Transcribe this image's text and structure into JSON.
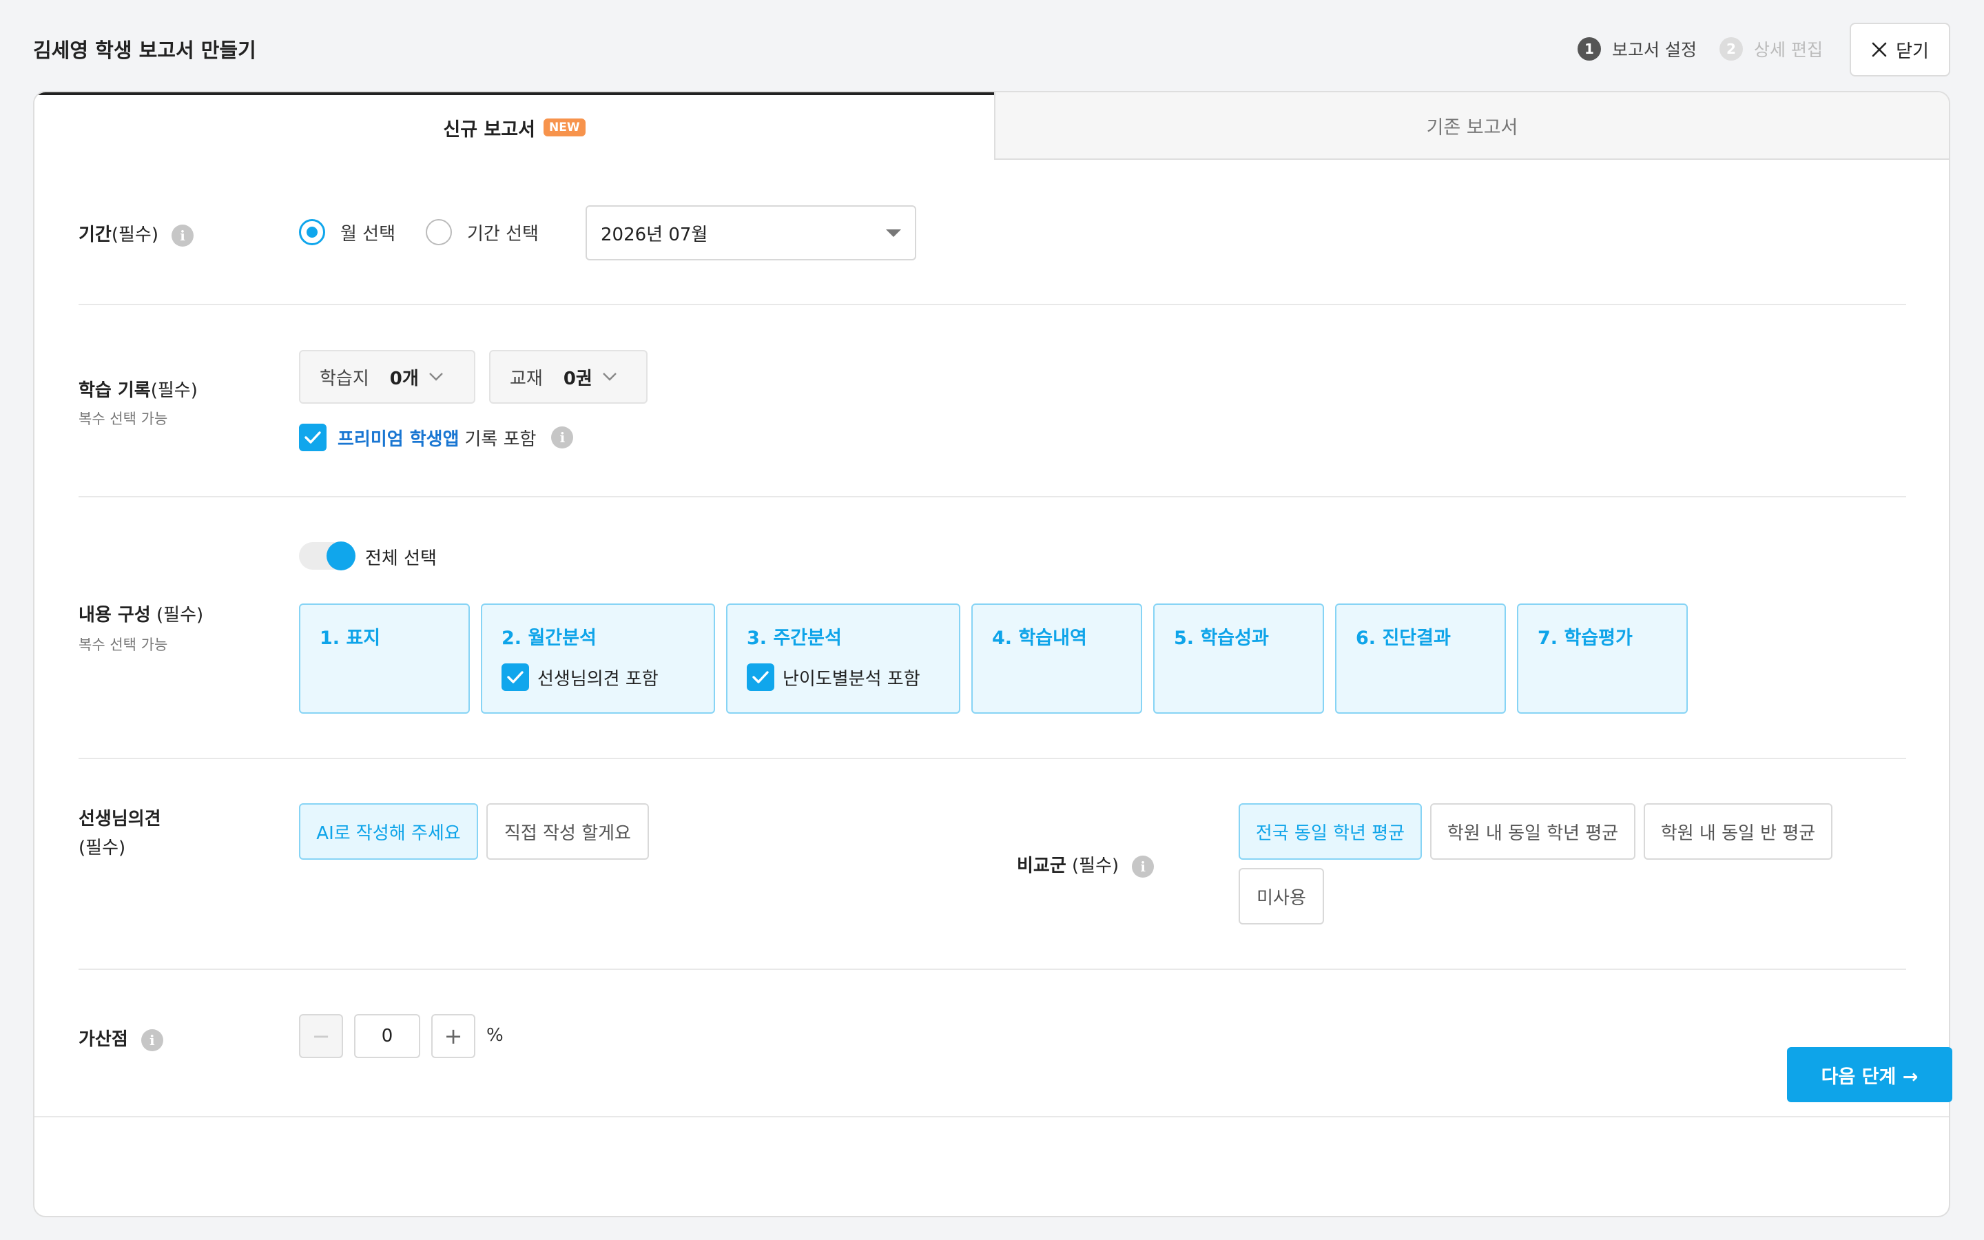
{
  "header": {
    "title": "김세영 학생 보고서 만들기",
    "steps": [
      {
        "num": "1",
        "label": "보고서 설정"
      },
      {
        "num": "2",
        "label": "상세 편집"
      }
    ],
    "close_label": "닫기"
  },
  "tabs": {
    "new_label": "신규 보고서",
    "new_badge": "NEW",
    "existing_label": "기존 보고서"
  },
  "period": {
    "label": "기간",
    "required": "(필수)",
    "info": "i",
    "radio_month": "월 선택",
    "radio_range": "기간 선택",
    "selected_month": "2026년 07월"
  },
  "records": {
    "label": "학습 기록",
    "required": "(필수)",
    "sub": "복수 선택 가능",
    "worksheet_label": "학습지",
    "worksheet_count": "0개",
    "textbook_label": "교재",
    "textbook_count": "0권",
    "premium_highlight": "프리미엄 학생앱",
    "premium_rest": "기록 포함",
    "info": "i"
  },
  "content": {
    "label": "내용 구성",
    "required": " (필수)",
    "sub": "복수 선택 가능",
    "toggle_label": "전체 선택",
    "cards": [
      {
        "title": "1. 표지"
      },
      {
        "title": "2. 월간분석",
        "option": "선생님의견 포함"
      },
      {
        "title": "3. 주간분석",
        "option": "난이도별분석 포함"
      },
      {
        "title": "4. 학습내역"
      },
      {
        "title": "5. 학습성과"
      },
      {
        "title": "6. 진단결과"
      },
      {
        "title": "7. 학습평가"
      }
    ]
  },
  "opinion": {
    "label_line1": "선생님의견",
    "label_line2": "(필수)",
    "ai_option": "AI로 작성해 주세요",
    "manual_option": "직접 작성 할게요"
  },
  "comparison": {
    "label": "비교군",
    "required": " (필수)",
    "info": "i",
    "options": [
      "전국 동일 학년 평균",
      "학원 내 동일 학년 평균",
      "학원 내 동일 반 평균",
      "미사용"
    ]
  },
  "bonus": {
    "label": "가산점",
    "info": "i",
    "minus": "−",
    "value": "0",
    "plus": "+",
    "unit": "%"
  },
  "footer": {
    "next_label": "다음 단계 →"
  },
  "colors": {
    "accent": "#0ea4e9",
    "badge": "#f7934c"
  }
}
